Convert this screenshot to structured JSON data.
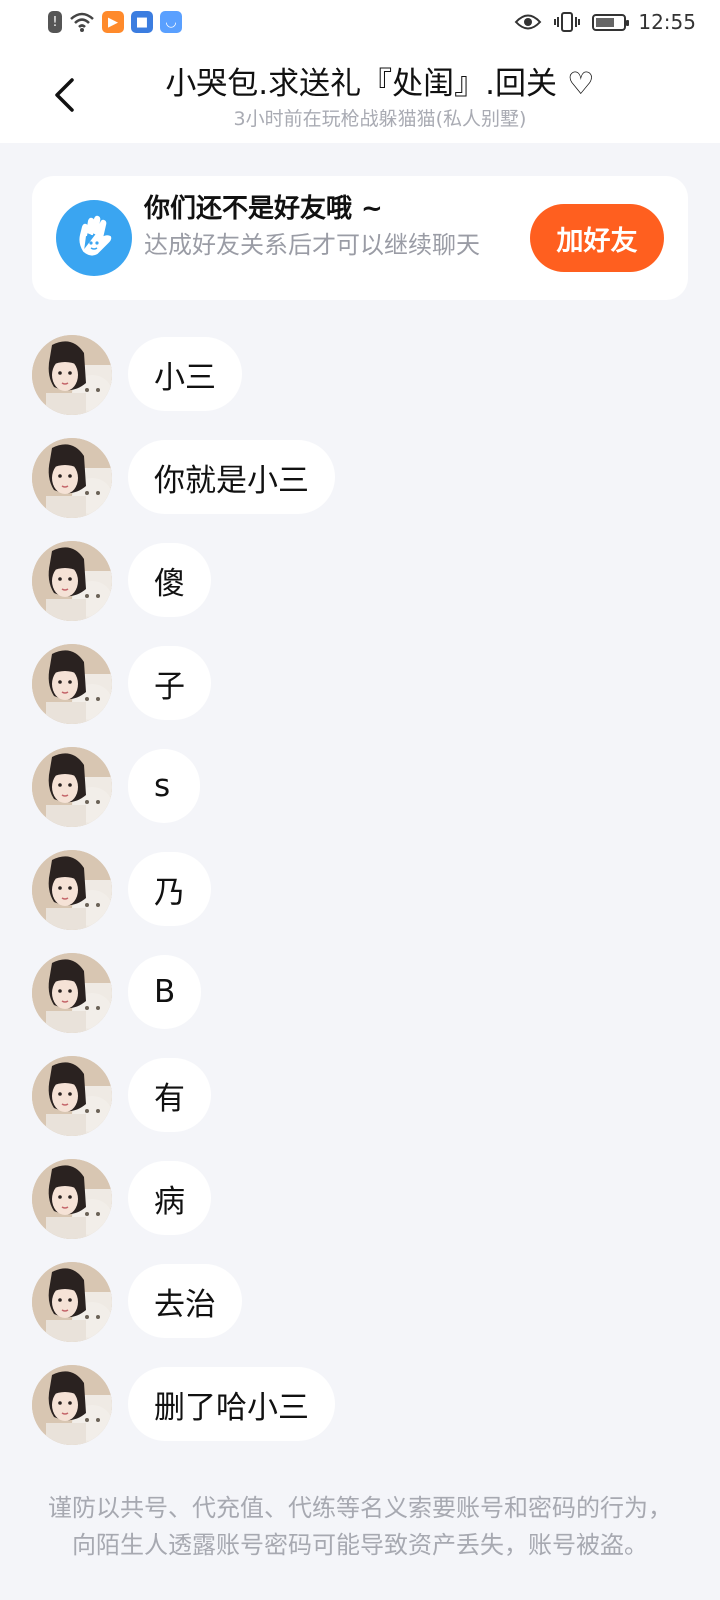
{
  "status_bar": {
    "time": "12:55"
  },
  "header": {
    "title": "小哭包.求送礼『处闺』.回关 ♡",
    "subtitle": "3小时前在玩枪战躲猫猫(私人别墅)"
  },
  "friend_card": {
    "title": "你们还不是好友哦 ~",
    "description": "达成好友关系后才可以继续聊天",
    "button_label": "加好友"
  },
  "messages": [
    {
      "text": "小三"
    },
    {
      "text": "你就是小三"
    },
    {
      "text": "傻"
    },
    {
      "text": "子"
    },
    {
      "text": "s"
    },
    {
      "text": "乃"
    },
    {
      "text": "B"
    },
    {
      "text": "有"
    },
    {
      "text": "病"
    },
    {
      "text": "去治"
    },
    {
      "text": "删了哈小三"
    }
  ],
  "notice": "谨防以共号、代充值、代练等名义索要账号和密码的行为，向陌生人透露账号密码可能导致资产丢失，账号被盗。",
  "colors": {
    "accent": "#ff5f1f",
    "icon_blue": "#3aa5f1",
    "background": "#f4f5f9"
  }
}
